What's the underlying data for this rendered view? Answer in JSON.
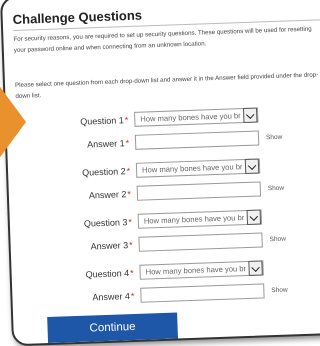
{
  "title": "Challenge Questions",
  "intro": "For security reasons, you are required to set up security questions. These questions will be used for resetting your password online and when connecting from an unknown location.",
  "instructions": "Please select one question from each drop-down list and answer it in the Answer field provided under the drop-down list.",
  "required_mark": "*",
  "questions": [
    {
      "question_label": "Question 1",
      "selected": "How many bones have you broken?",
      "answer_label": "Answer 1",
      "answer_value": "",
      "show_label": "Show"
    },
    {
      "question_label": "Question 2",
      "selected": "How many bones have you broken?",
      "answer_label": "Answer 2",
      "answer_value": "",
      "show_label": "Show"
    },
    {
      "question_label": "Question 3",
      "selected": "How many bones have you broken?",
      "answer_label": "Answer 3",
      "answer_value": "",
      "show_label": "Show"
    },
    {
      "question_label": "Question 4",
      "selected": "How many bones have you broken?",
      "answer_label": "Answer 4",
      "answer_value": "",
      "show_label": "Show"
    }
  ],
  "continue_label": "Continue",
  "colors": {
    "accent_arrow": "#e8912d",
    "button": "#1f57a8",
    "required": "#d9261c"
  }
}
